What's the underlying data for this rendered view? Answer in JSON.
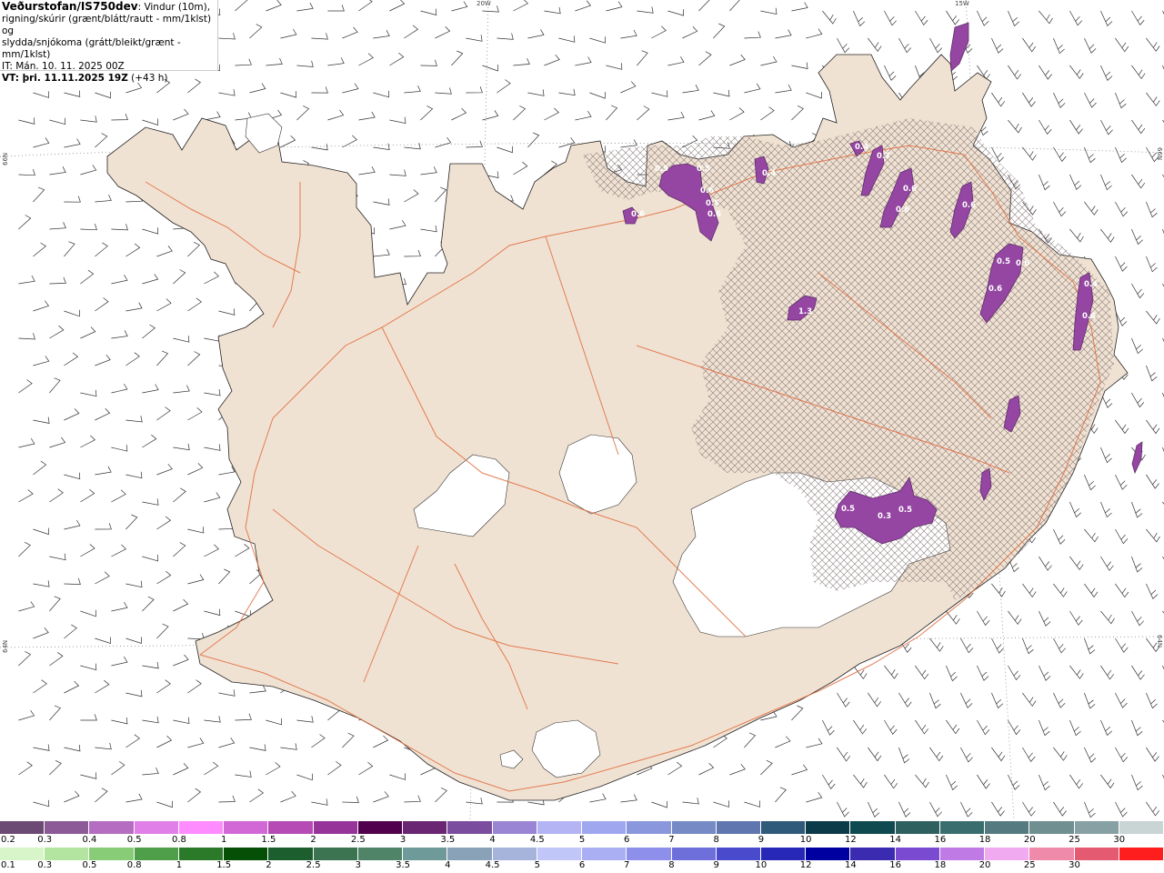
{
  "header": {
    "brand": "Veðurstofan/IS750dev",
    "line1_rest": ": Vindur (10m),",
    "line2": "rigning/skúrir (grænt/blátt/rautt - mm/1klst) og",
    "line3": "slydda/snjókoma (grátt/bleikt/grænt - mm/1klst)",
    "line4": "IT: Mán. 10. 11. 2025 00Z",
    "vt_label": "VT: þri. 11.11.2025 19Z",
    "vt_rest": " (+43 h)"
  },
  "grid_labels": {
    "top_20w": "20W",
    "top_15w": "15W",
    "left_66n": "66N",
    "left_64n": "64N",
    "right_66n": "66N",
    "right_64n": "64N"
  },
  "map_values": {
    "snow_labels": [
      "0.5",
      "0.5",
      "0.6",
      "0.5",
      "0.6",
      "0.6",
      "0.4",
      "0.4",
      "0.7",
      "0.6",
      "0.6",
      "0.6",
      "0.5",
      "0.6",
      "0.6",
      "1.3",
      "0.4",
      "0.6",
      "0.5",
      "0.3",
      "0.5"
    ]
  },
  "legend_snow": {
    "colors": [
      "#6b4a73",
      "#8c5a96",
      "#b46dc0",
      "#e07fe8",
      "#ff8cff",
      "#d267d6",
      "#b64bb6",
      "#96349a",
      "#50004c",
      "#6a2672",
      "#7b4d9e",
      "#9a85d4",
      "#b4b4f5",
      "#9fa7ee",
      "#8a97dc",
      "#768ac6",
      "#5f77ae",
      "#2f5a7a",
      "#0b3a48",
      "#0f4a50",
      "#2f6060",
      "#3a6e6e",
      "#557a80",
      "#6f8f90",
      "#86a0a4",
      "#c9d4d4"
    ],
    "labels": [
      "0.2",
      "0.3",
      "0.4",
      "0.5",
      "0.8",
      "1",
      "1.5",
      "2",
      "2.5",
      "3",
      "3.5",
      "4",
      "4.5",
      "5",
      "6",
      "7",
      "8",
      "9",
      "10",
      "12",
      "14",
      "16",
      "18",
      "20",
      "25",
      "30"
    ]
  },
  "legend_rain": {
    "colors": [
      "#d7f5c8",
      "#b4e5a0",
      "#88cc78",
      "#4f9e4a",
      "#2a7a2a",
      "#064f06",
      "#1c5e2e",
      "#3c7350",
      "#4f8468",
      "#6f9a9a",
      "#8aa2b8",
      "#a6b4dc",
      "#c0c6f8",
      "#a9aff2",
      "#8d8fea",
      "#6f6fdc",
      "#4a4acc",
      "#2828b8",
      "#0000a0",
      "#3a2bb0",
      "#7a4ad0",
      "#c07ae6",
      "#f0aaf0",
      "#f08aaa",
      "#e45a70",
      "#ff1e1e"
    ],
    "labels": [
      "0.1",
      "0.3",
      "0.5",
      "0.8",
      "1",
      "1.5",
      "2",
      "2.5",
      "3",
      "3.5",
      "4",
      "4.5",
      "5",
      "6",
      "7",
      "8",
      "9",
      "10",
      "12",
      "14",
      "16",
      "18",
      "20",
      "25",
      "30"
    ]
  },
  "colors": {
    "land": "#f0e2d3",
    "coast": "#222222",
    "roads": "#e06a3a",
    "glacier": "#ffffff",
    "snow_fill": "#9446a2",
    "snow_dark": "#5f2f6a"
  }
}
